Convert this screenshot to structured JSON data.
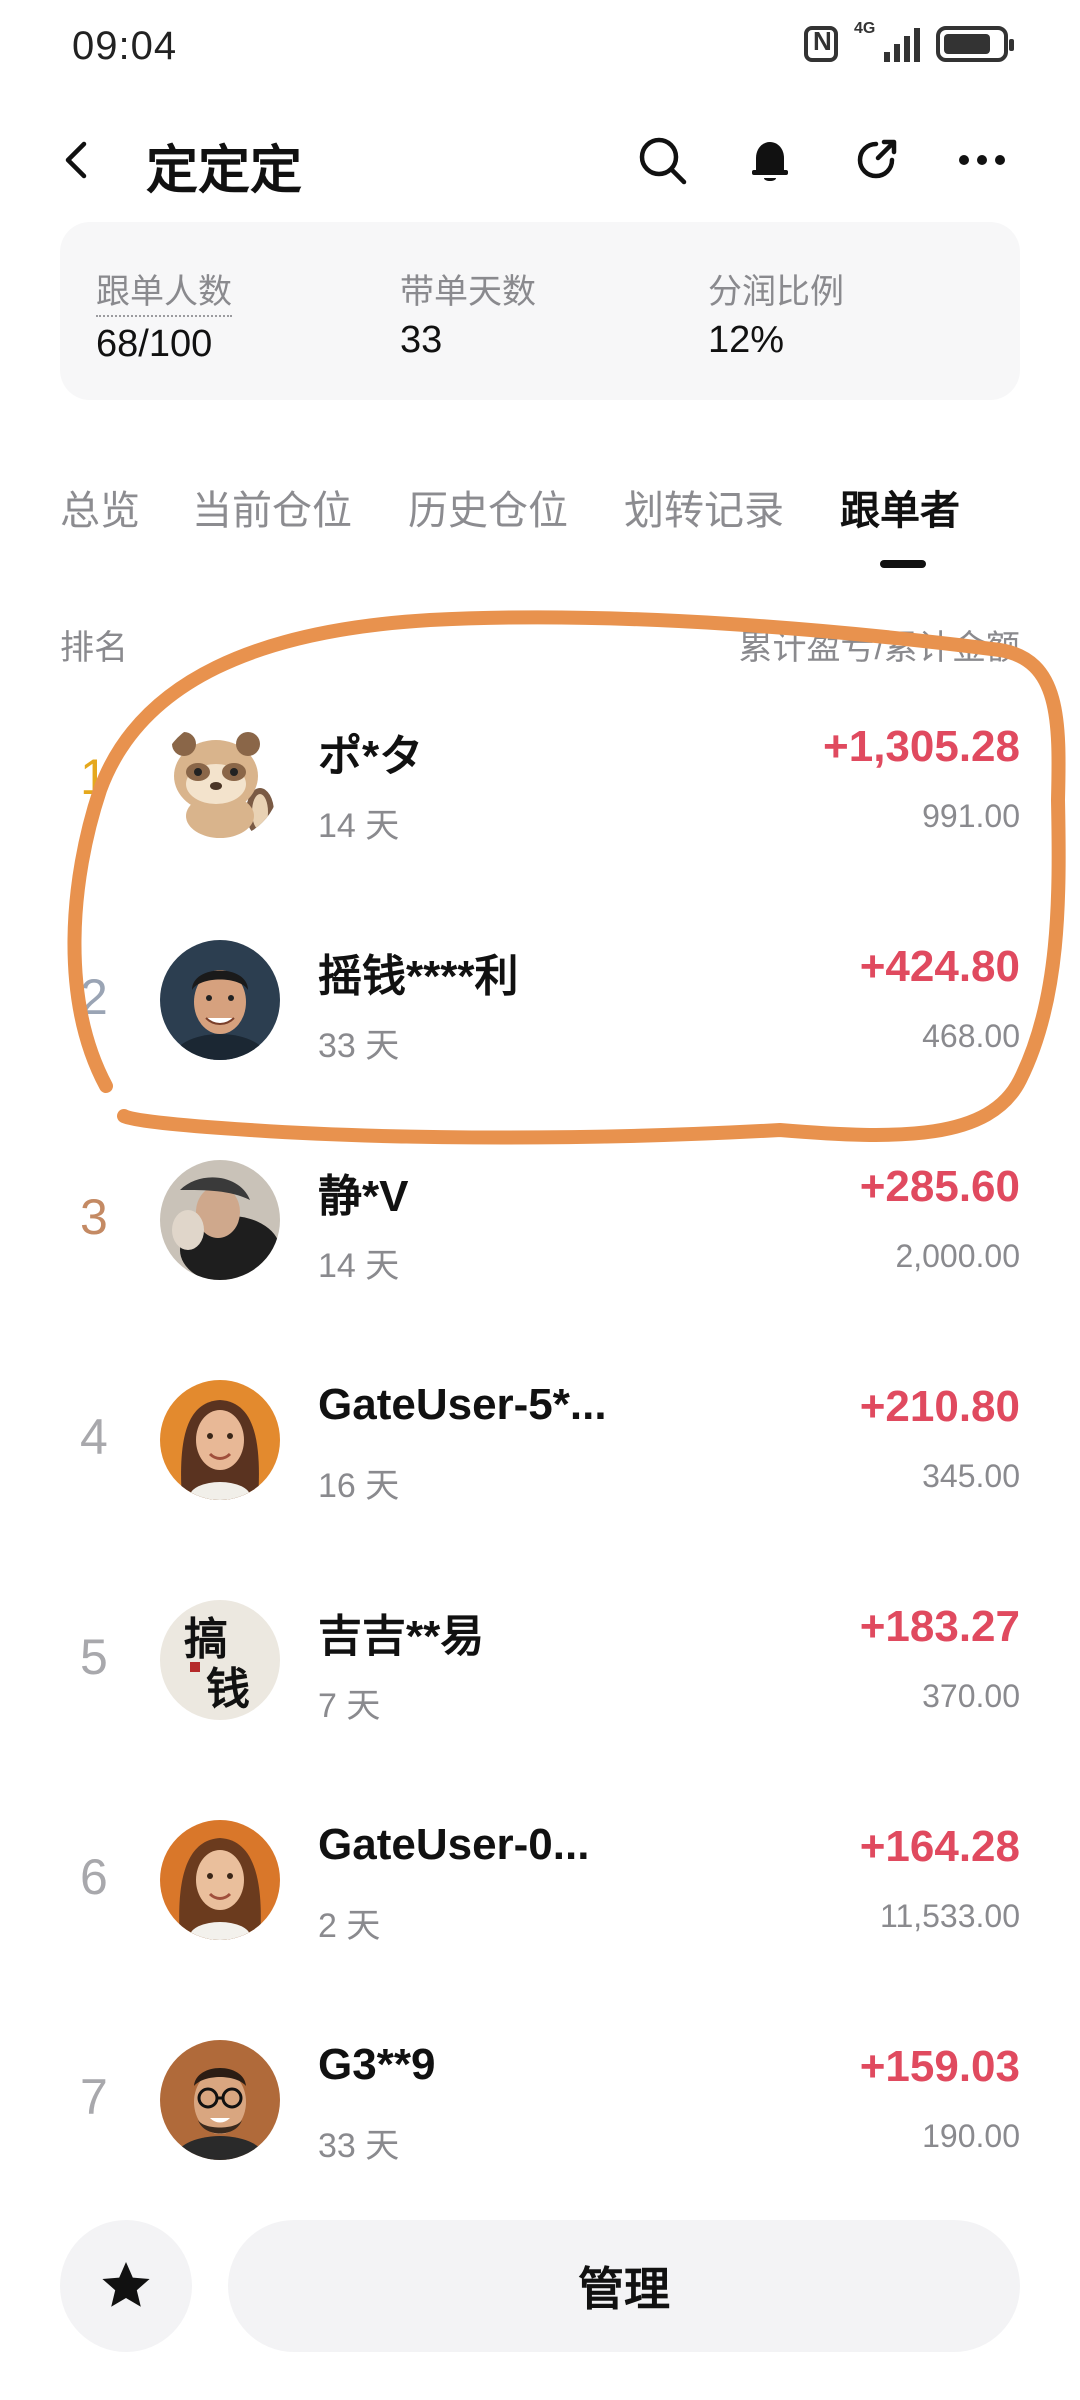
{
  "status_bar": {
    "time": "09:04",
    "network": "4G",
    "icons": [
      "nfc-icon",
      "signal-icon",
      "battery-icon"
    ]
  },
  "nav": {
    "title": "定定定",
    "icons": [
      "back-icon",
      "search-icon",
      "bell-icon",
      "share-icon",
      "more-icon"
    ]
  },
  "stats": [
    {
      "label": "跟单人数",
      "value": "68/100"
    },
    {
      "label": "带单天数",
      "value": "33"
    },
    {
      "label": "分润比例",
      "value": "12%"
    }
  ],
  "tabs": [
    {
      "label": "总览",
      "active": false
    },
    {
      "label": "当前仓位",
      "active": false
    },
    {
      "label": "历史仓位",
      "active": false
    },
    {
      "label": "划转记录",
      "active": false
    },
    {
      "label": "跟单者",
      "active": true
    }
  ],
  "list_header": {
    "rank": "排名",
    "right": "累计盈亏/累计金额"
  },
  "followers": [
    {
      "rank": "1",
      "name": "ポ*タ",
      "days": "14 天",
      "pnl": "+1,305.28",
      "amount": "991.00",
      "avatar": "raccoon-avatar"
    },
    {
      "rank": "2",
      "name": "摇钱****利",
      "days": "33 天",
      "pnl": "+424.80",
      "amount": "468.00",
      "avatar": "man-avatar"
    },
    {
      "rank": "3",
      "name": "静*V",
      "days": "14 天",
      "pnl": "+285.60",
      "amount": "2,000.00",
      "avatar": "photo-avatar"
    },
    {
      "rank": "4",
      "name": "GateUser-5*...",
      "days": "16 天",
      "pnl": "+210.80",
      "amount": "345.00",
      "avatar": "woman-avatar"
    },
    {
      "rank": "5",
      "name": "吉吉**易",
      "days": "7 天",
      "pnl": "+183.27",
      "amount": "370.00",
      "avatar": "calligraphy-avatar",
      "avatar_text": "搞钱"
    },
    {
      "rank": "6",
      "name": "GateUser-0...",
      "days": "2 天",
      "pnl": "+164.28",
      "amount": "11,533.00",
      "avatar": "woman-avatar"
    },
    {
      "rank": "7",
      "name": "G3**9",
      "days": "33 天",
      "pnl": "+159.03",
      "amount": "190.00",
      "avatar": "glasses-man-avatar"
    }
  ],
  "bottom": {
    "star_icon": "star-icon",
    "manage_label": "管理"
  },
  "colors": {
    "profit": "#e04a5f",
    "highlight": "#e8924e",
    "rank_gold": "#e5a81c",
    "rank_silver": "#9aa4b4",
    "rank_bronze": "#c48a64"
  }
}
